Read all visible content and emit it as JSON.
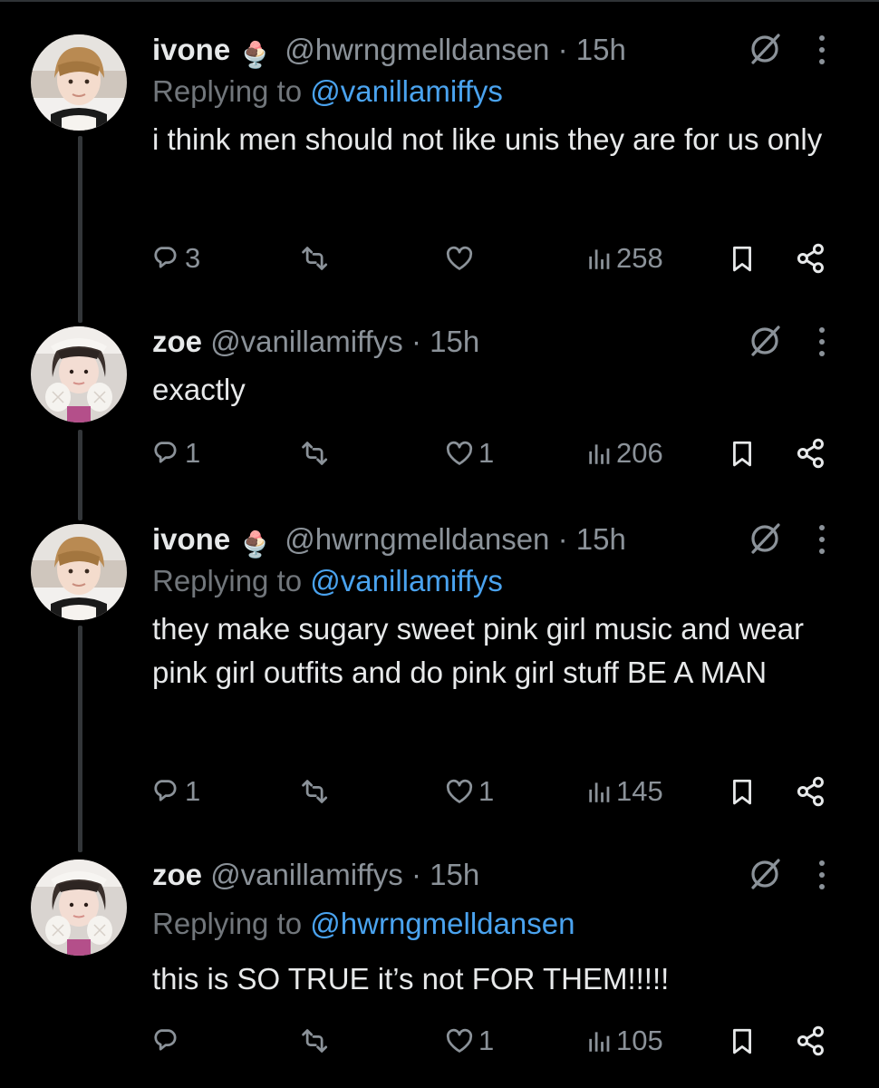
{
  "tweets": [
    {
      "name": "ivone",
      "emoji": "🍨",
      "handle": "@hwrngmelldansen",
      "dot": "·",
      "time": "15h",
      "replying_prefix": "Replying to",
      "replying_to": "@vanillamiffys",
      "text": "i think men should not like unis they are for us only",
      "replies": "3",
      "retweets": "",
      "likes": "",
      "views": "258"
    },
    {
      "name": "zoe",
      "handle": "@vanillamiffys",
      "dot": "·",
      "time": "15h",
      "text": "exactly",
      "replies": "1",
      "retweets": "",
      "likes": "1",
      "views": "206"
    },
    {
      "name": "ivone",
      "emoji": "🍨",
      "handle": "@hwrngmelldansen",
      "dot": "·",
      "time": "15h",
      "replying_prefix": "Replying to",
      "replying_to": "@vanillamiffys",
      "text": "they make sugary sweet pink girl music and wear pink girl outfits and do pink girl stuff BE A MAN",
      "replies": "1",
      "retweets": "",
      "likes": "1",
      "views": "145"
    },
    {
      "name": "zoe",
      "handle": "@vanillamiffys",
      "dot": "·",
      "time": "15h",
      "replying_prefix": "Replying to",
      "replying_to": "@hwrngmelldansen",
      "text": "this is SO TRUE it’s not FOR THEM!!!!!",
      "replies": "",
      "retweets": "",
      "likes": "1",
      "views": "105"
    }
  ],
  "icons": {
    "header": [
      "grok-slash-icon",
      "more-vertical-icon"
    ],
    "actions": [
      "reply-icon",
      "retweet-icon",
      "like-icon",
      "views-icon",
      "bookmark-icon",
      "share-icon"
    ]
  },
  "colors": {
    "background": "#000000",
    "text": "#e7e9ea",
    "muted": "#71767b",
    "link": "#1d9bf0",
    "thread_line": "#333639"
  }
}
